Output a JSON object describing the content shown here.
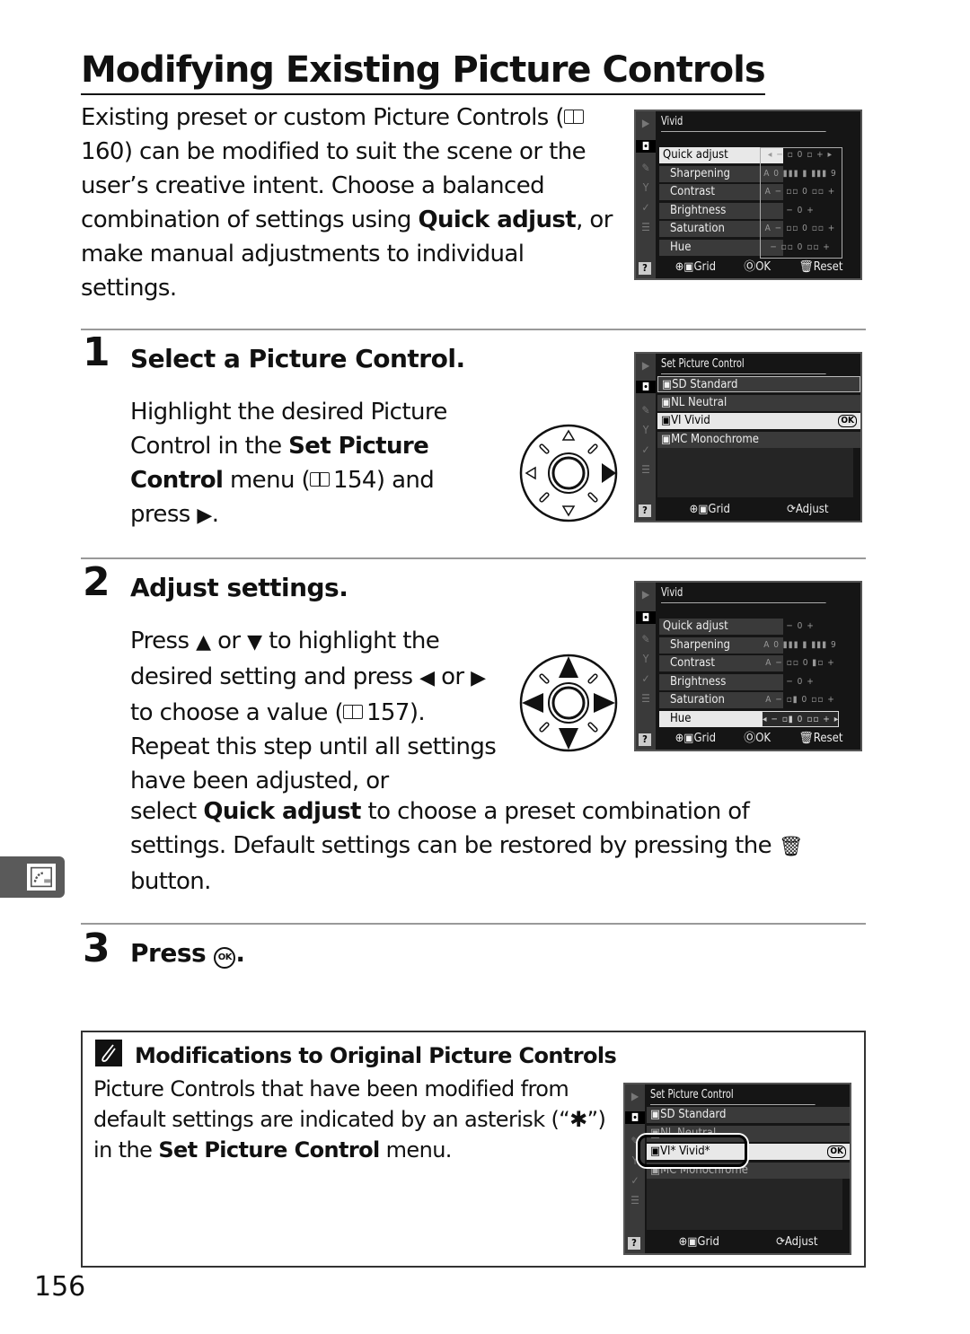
{
  "page": {
    "title": "Modifying Existing Picture Controls",
    "intro": {
      "before_ref": "Existing preset or custom Picture Controls (",
      "ref": "160",
      "after_ref": ") can be modified to suit the scene or the user’s creative intent.  Choose a balanced combination of settings using ",
      "bold": "Quick adjust",
      "end": ", or make manual adjustments to individual settings."
    },
    "page_number": "156"
  },
  "steps": [
    {
      "number": "1",
      "title": "Select a Picture Control.",
      "body": {
        "t1": "Highlight the desired Picture Control in the ",
        "b1": "Set Picture Control",
        "t2": " menu (",
        "ref": "154",
        "t3": ") and press ",
        "arrow": "▶",
        "t4": "."
      }
    },
    {
      "number": "2",
      "title": "Adjust settings.",
      "body": {
        "t1": "Press ",
        "up": "▲",
        "t2": " or ",
        "down": "▼",
        "t3": " to highlight the desired setting and press ",
        "left": "◀",
        "t4": " or ",
        "right": "▶",
        "t5": " to choose a value (",
        "ref": "157",
        "t6": "). Repeat this step until all settings have been adjusted, or",
        "t7": "select ",
        "b1": "Quick adjust",
        "t8": " to choose a preset combination of settings.  Default settings can be restored by pressing the ",
        "trash": "🗑",
        "t9": "button."
      }
    },
    {
      "number": "3",
      "title_prefix": "Press ",
      "title_glyph": "OK",
      "title_suffix": "."
    }
  ],
  "screens": {
    "vivid_1": {
      "title": "Vivid",
      "rows": [
        {
          "label": "Quick adjust",
          "value": "◂ − ▫ 0 ▫ + ▸",
          "selected": true
        },
        {
          "label": "Sharpening",
          "value": "A 0 ▮▮▮ ▮ ▮▮▮ 9"
        },
        {
          "label": "Contrast",
          "value": "A − ▫▫ 0 ▫▫ +"
        },
        {
          "label": "Brightness",
          "value": "− 0 +"
        },
        {
          "label": "Saturation",
          "value": "A − ▫▫ 0 ▫▫ +"
        },
        {
          "label": "Hue",
          "value": "− ▫▫ 0 ▫▫ +"
        }
      ],
      "footer": [
        "Grid",
        "OK",
        "Reset"
      ]
    },
    "set_pc_1": {
      "title": "Set Picture Control",
      "items": [
        {
          "code": "SD",
          "name": "Standard"
        },
        {
          "code": "NL",
          "name": "Neutral"
        },
        {
          "code": "VI",
          "name": "Vivid",
          "selected": true,
          "ok": "OK"
        },
        {
          "code": "MC",
          "name": "Monochrome"
        }
      ],
      "footer": [
        "Grid",
        "Adjust"
      ]
    },
    "vivid_2": {
      "title": "Vivid",
      "rows": [
        {
          "label": "Quick adjust",
          "value": "− 0 +"
        },
        {
          "label": "Sharpening",
          "value": "A 0 ▮▮▮ ▮ ▮▮▮ 9"
        },
        {
          "label": "Contrast",
          "value": "A − ▫▫ 0 ▮▫ +"
        },
        {
          "label": "Brightness",
          "value": "− 0 +"
        },
        {
          "label": "Saturation",
          "value": "A − ▫▮ 0 ▫▫ +"
        },
        {
          "label": "Hue",
          "value": "◂ − ▫▮ 0 ▫▫ + ▸",
          "selected": true
        }
      ],
      "footer": [
        "Grid",
        "OK",
        "Reset"
      ]
    },
    "set_pc_2": {
      "title": "Set Picture Control",
      "items": [
        {
          "code": "SD",
          "name": "Standard"
        },
        {
          "code": "NL",
          "name": "Neutral"
        },
        {
          "code": "VI*",
          "name": "Vivid*",
          "selected": true,
          "ok": "OK"
        },
        {
          "code": "MC",
          "name": "Monochrome"
        }
      ],
      "footer": [
        "Grid",
        "Adjust"
      ]
    }
  },
  "note": {
    "title": "Modifications to Original Picture Controls",
    "t1": "Picture Controls that have been modified from default settings are indicated by an asterisk (“",
    "asterisk": "✱",
    "t2": "”) in the ",
    "b1": "Set Picture Control",
    "t3": " menu."
  }
}
